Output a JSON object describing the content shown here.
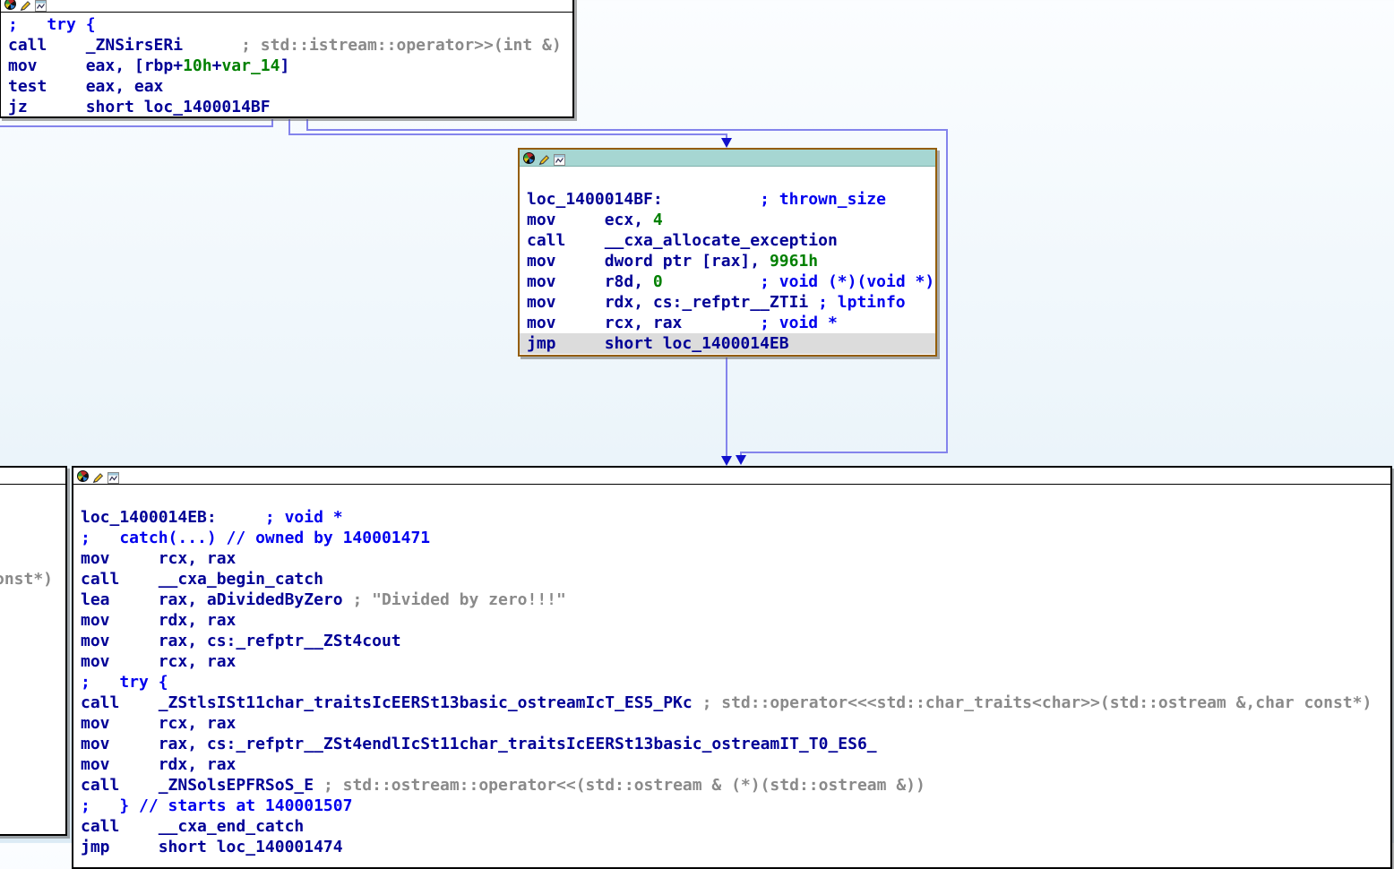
{
  "app": {
    "view": "ida-pro-graph-view"
  },
  "colors": {
    "code": "#000096",
    "number": "#008000",
    "comment_auto": "#8a8a8a",
    "comment_user": "#0000ee",
    "edge": "#8484ec",
    "arrowhead": "#1111cc",
    "current_node_border": "#945e0a",
    "current_node_titlebar": "#a6d6d2",
    "highlight_line": "#dcdcdc",
    "node_bg": "#ffffff"
  },
  "titlebar_icons": [
    "color-wheel-icon",
    "edit-icon",
    "graph-icon"
  ],
  "blocks": {
    "top": {
      "lines": [
        {
          "segs": [
            [
              "cb",
              ";   try {"
            ]
          ]
        },
        {
          "segs": [
            [
              "k",
              "call    _ZNSirsERi      "
            ],
            [
              "cg",
              "; std::istream::operator>>(int &)"
            ]
          ]
        },
        {
          "segs": [
            [
              "k",
              "mov     eax, [rbp+"
            ],
            [
              "n",
              "10h"
            ],
            [
              "k",
              "+"
            ],
            [
              "n",
              "var_14"
            ],
            [
              "k",
              "]"
            ]
          ]
        },
        {
          "segs": [
            [
              "k",
              "test    eax, eax"
            ]
          ]
        },
        {
          "segs": [
            [
              "k",
              "jz      short loc_1400014BF"
            ]
          ]
        }
      ]
    },
    "exception": {
      "lines": [
        {
          "segs": []
        },
        {
          "segs": [
            [
              "k",
              "loc_1400014BF:"
            ],
            [
              "k",
              "          "
            ],
            [
              "cb",
              "; thrown_size"
            ]
          ]
        },
        {
          "segs": [
            [
              "k",
              "mov     ecx, "
            ],
            [
              "n",
              "4"
            ]
          ]
        },
        {
          "segs": [
            [
              "k",
              "call    __cxa_allocate_exception"
            ]
          ]
        },
        {
          "segs": [
            [
              "k",
              "mov     dword ptr [rax], "
            ],
            [
              "n",
              "9961h"
            ]
          ]
        },
        {
          "segs": [
            [
              "k",
              "mov     r8d, "
            ],
            [
              "n",
              "0"
            ],
            [
              "k",
              "          "
            ],
            [
              "cb",
              "; void (*)(void *)"
            ]
          ]
        },
        {
          "segs": [
            [
              "k",
              "mov     rdx, cs:_refptr__ZTIi "
            ],
            [
              "cb",
              "; lptinfo"
            ]
          ]
        },
        {
          "segs": [
            [
              "k",
              "mov     rcx, rax        "
            ],
            [
              "cb",
              "; void *"
            ]
          ]
        },
        {
          "hl": true,
          "segs": [
            [
              "k",
              "jmp     short loc_1400014EB"
            ]
          ]
        }
      ]
    },
    "catch": {
      "lines": [
        {
          "segs": []
        },
        {
          "segs": [
            [
              "k",
              "loc_1400014EB:"
            ],
            [
              "k",
              "     "
            ],
            [
              "cb",
              "; void *"
            ]
          ]
        },
        {
          "segs": [
            [
              "cb",
              ";   catch(...) // owned by 140001471"
            ]
          ]
        },
        {
          "segs": [
            [
              "k",
              "mov     rcx, rax"
            ]
          ]
        },
        {
          "segs": [
            [
              "k",
              "call    __cxa_begin_catch"
            ]
          ]
        },
        {
          "segs": [
            [
              "k",
              "lea     rax, aDividedByZero "
            ],
            [
              "cg",
              "; \"Divided by zero!!!\""
            ]
          ]
        },
        {
          "segs": [
            [
              "k",
              "mov     rdx, rax"
            ]
          ]
        },
        {
          "segs": [
            [
              "k",
              "mov     rax, cs:_refptr__ZSt4cout"
            ]
          ]
        },
        {
          "segs": [
            [
              "k",
              "mov     rcx, rax"
            ]
          ]
        },
        {
          "segs": [
            [
              "cb",
              ";   try {"
            ]
          ]
        },
        {
          "segs": [
            [
              "k",
              "call    _ZStlsISt11char_traitsIcEERSt13basic_ostreamIcT_ES5_PKc "
            ],
            [
              "cg",
              "; std::operator<<<std::char_traits<char>>(std::ostream &,char const*)"
            ]
          ]
        },
        {
          "segs": [
            [
              "k",
              "mov     rcx, rax"
            ]
          ]
        },
        {
          "segs": [
            [
              "k",
              "mov     rax, cs:_refptr__ZSt4endlIcSt11char_traitsIcEERSt13basic_ostreamIT_T0_ES6_"
            ]
          ]
        },
        {
          "segs": [
            [
              "k",
              "mov     rdx, rax"
            ]
          ]
        },
        {
          "segs": [
            [
              "k",
              "call    _ZNSolsEPFRSoS_E "
            ],
            [
              "cg",
              "; std::ostream::operator<<(std::ostream & (*)(std::ostream &))"
            ]
          ]
        },
        {
          "segs": [
            [
              "cb",
              ";   } // starts at 140001507"
            ]
          ]
        },
        {
          "segs": [
            [
              "k",
              "call    __cxa_end_catch"
            ]
          ]
        },
        {
          "segs": [
            [
              "k",
              "jmp     short loc_140001474"
            ]
          ]
        }
      ]
    },
    "left_partial": {
      "lines": [
        {
          "segs": []
        },
        {
          "segs": []
        },
        {
          "segs": []
        },
        {
          "segs": []
        },
        {
          "segs": [
            [
              "cg",
              "onst*)"
            ]
          ]
        }
      ]
    }
  }
}
